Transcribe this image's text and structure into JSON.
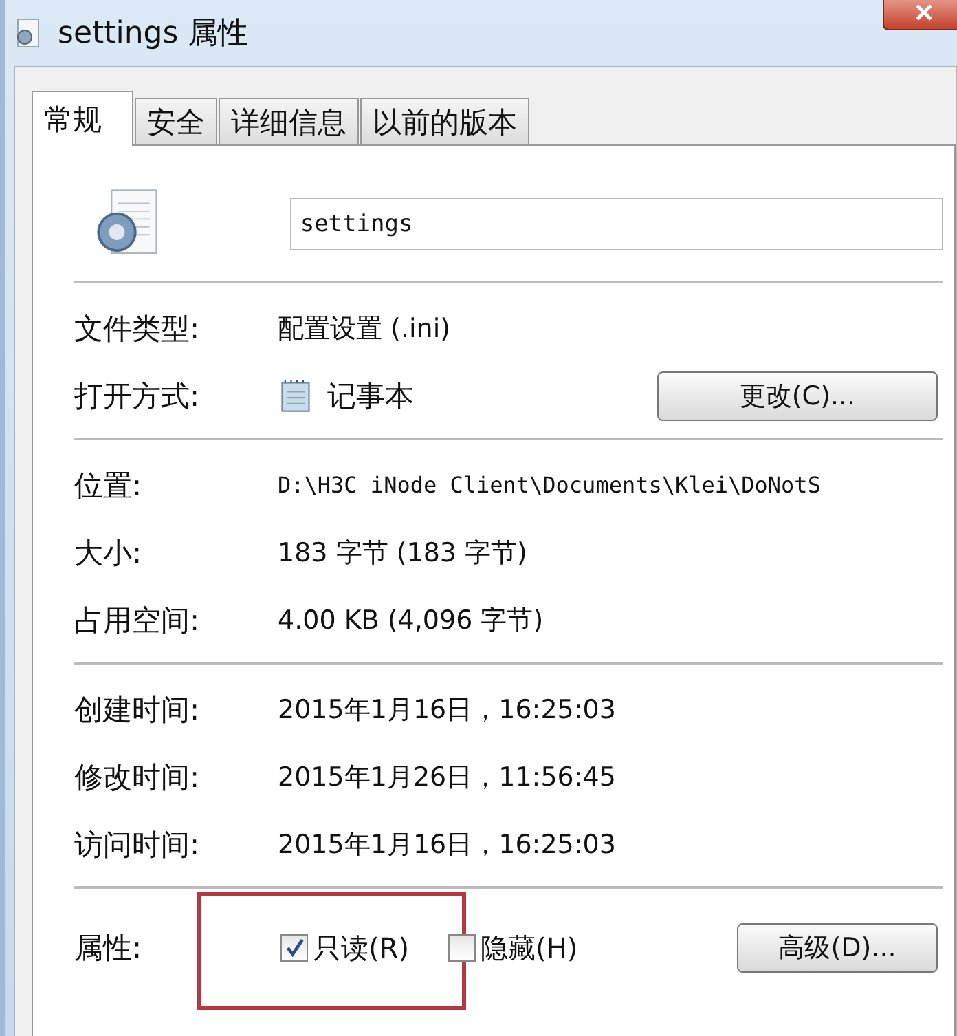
{
  "window": {
    "title": "settings 属性"
  },
  "tabs": [
    {
      "label": "常规",
      "selected": true
    },
    {
      "label": "安全",
      "selected": false
    },
    {
      "label": "详细信息",
      "selected": false
    },
    {
      "label": "以前的版本",
      "selected": false
    }
  ],
  "file_name": "settings",
  "file_type": {
    "label": "文件类型:",
    "value": "配置设置 (.ini)"
  },
  "open_with": {
    "label": "打开方式:",
    "app": "记事本",
    "button": "更改(C)..."
  },
  "details": [
    {
      "label": "位置:",
      "value": "D:\\H3C iNode Client\\Documents\\Klei\\DoNotS",
      "kind": "path"
    },
    {
      "label": "大小:",
      "value": "183 字节 (183 字节)",
      "kind": "plain"
    },
    {
      "label": "占用空间:",
      "value": "4.00 KB (4,096 字节)",
      "kind": "plain"
    }
  ],
  "times": [
    {
      "label": "创建时间:",
      "value": "2015年1月16日，16:25:03"
    },
    {
      "label": "修改时间:",
      "value": "2015年1月26日，11:56:45"
    },
    {
      "label": "访问时间:",
      "value": "2015年1月16日，16:25:03"
    }
  ],
  "attributes": {
    "label": "属性:",
    "checkboxes": [
      {
        "label": "只读(R)",
        "checked": true
      },
      {
        "label": "隐藏(H)",
        "checked": false
      }
    ],
    "button": "高级(D)..."
  }
}
